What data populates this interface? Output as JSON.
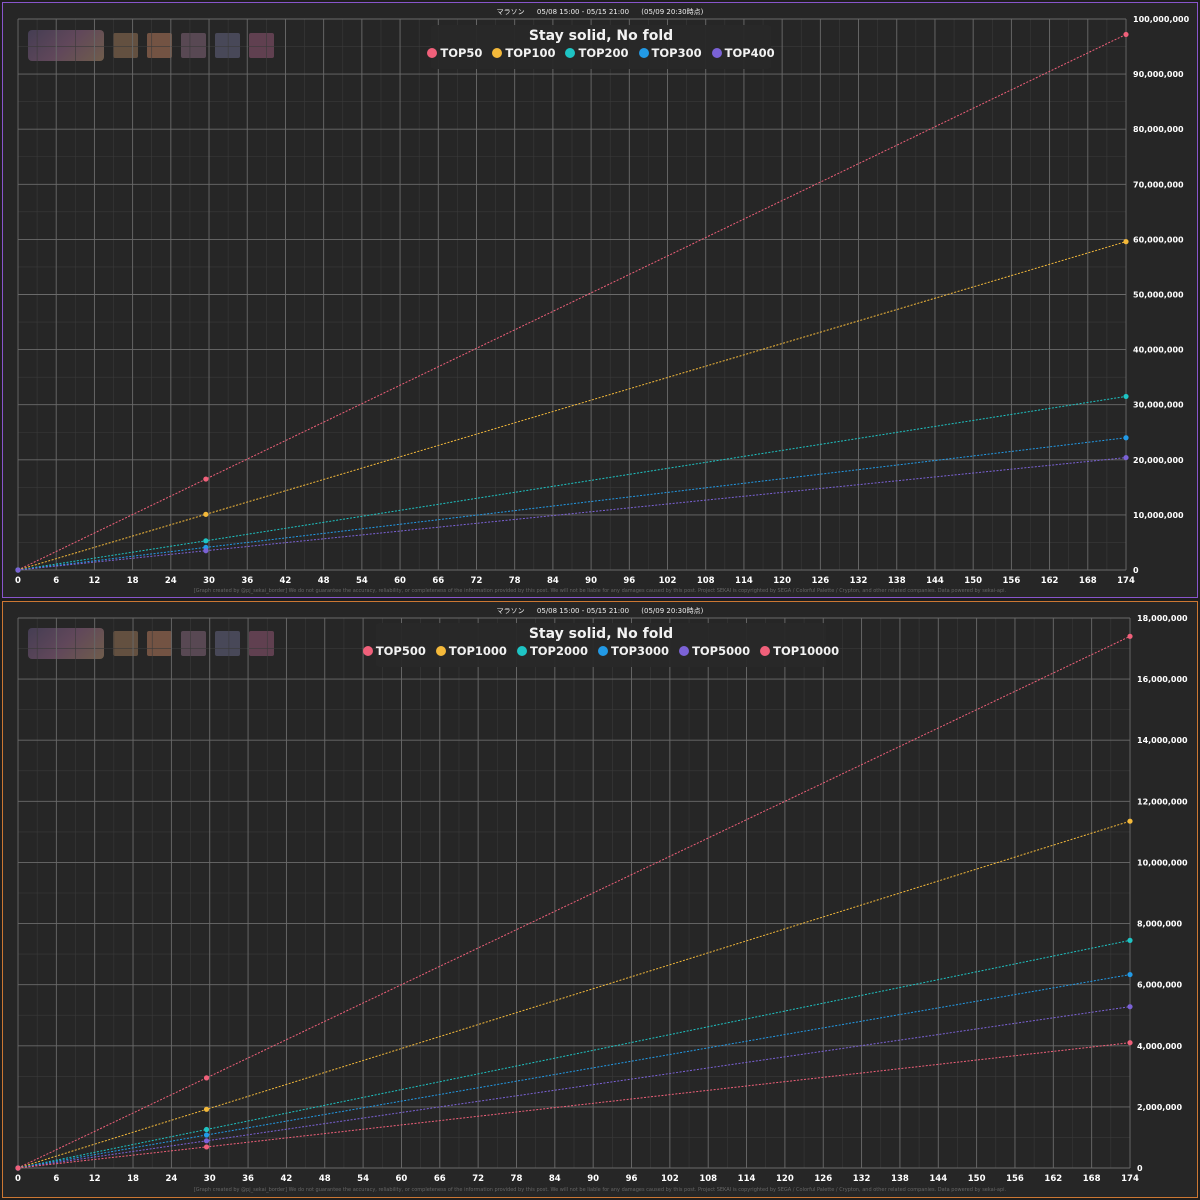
{
  "colors": {
    "red": "#f0607a",
    "yellow": "#f4b93a",
    "teal": "#1ec4c4",
    "blue": "#229ae6",
    "purple": "#7b62d6",
    "frame_top": "#8855cc",
    "frame_bottom": "#cc7733"
  },
  "header": {
    "event_type": "マラソン",
    "period": "05/08 15:00 - 05/15 21:00",
    "as_of": "(05/09 20:30時点)"
  },
  "footer_text": "[Graph created by @pj_sekai_border]  We do not guarantee the accuracy, reliability, or completeness of the information provided by this post. We will not be liable for any damages caused by this post. Project SEKAI is copyrighted by SEGA / Colorful Palette / Crypton, and other related companies. Data powered by sekai-api.",
  "thumbnails": [
    "logo-image",
    "character-1-image",
    "character-2-image",
    "character-3-image",
    "character-4-image",
    "character-5-image"
  ],
  "chart_data": [
    {
      "type": "line",
      "title": "Stay solid, No fold",
      "x_ticks": [
        0,
        6,
        12,
        18,
        24,
        30,
        36,
        42,
        48,
        54,
        60,
        66,
        72,
        78,
        84,
        90,
        96,
        102,
        108,
        114,
        120,
        126,
        132,
        138,
        144,
        150,
        156,
        162,
        168,
        174
      ],
      "xlim": [
        0,
        174
      ],
      "ylim": [
        0,
        100000000
      ],
      "y_ticks": [
        0,
        10000000,
        20000000,
        30000000,
        40000000,
        50000000,
        60000000,
        70000000,
        80000000,
        90000000,
        100000000
      ],
      "y_tick_labels": [
        "0",
        "10,000,000",
        "20,000,000",
        "30,000,000",
        "40,000,000",
        "50,000,000",
        "60,000,000",
        "70,000,000",
        "80,000,000",
        "90,000,000",
        "100,000,000"
      ],
      "grid": true,
      "legend_position": "top-center",
      "series": [
        {
          "name": "TOP50",
          "color_key": "red",
          "points": [
            [
              0,
              0
            ],
            [
              29.5,
              16500000
            ],
            [
              174,
              97200000
            ]
          ]
        },
        {
          "name": "TOP100",
          "color_key": "yellow",
          "points": [
            [
              0,
              0
            ],
            [
              29.5,
              10100000
            ],
            [
              174,
              59600000
            ]
          ]
        },
        {
          "name": "TOP200",
          "color_key": "teal",
          "points": [
            [
              0,
              0
            ],
            [
              29.5,
              5300000
            ],
            [
              174,
              31500000
            ]
          ]
        },
        {
          "name": "TOP300",
          "color_key": "blue",
          "points": [
            [
              0,
              0
            ],
            [
              29.5,
              4100000
            ],
            [
              174,
              24000000
            ]
          ]
        },
        {
          "name": "TOP400",
          "color_key": "purple",
          "points": [
            [
              0,
              0
            ],
            [
              29.5,
              3500000
            ],
            [
              174,
              20400000
            ]
          ]
        }
      ]
    },
    {
      "type": "line",
      "title": "Stay solid, No fold",
      "x_ticks": [
        0,
        6,
        12,
        18,
        24,
        30,
        36,
        42,
        48,
        54,
        60,
        66,
        72,
        78,
        84,
        90,
        96,
        102,
        108,
        114,
        120,
        126,
        132,
        138,
        144,
        150,
        156,
        162,
        168,
        174
      ],
      "xlim": [
        0,
        174
      ],
      "ylim": [
        0,
        18000000
      ],
      "y_ticks": [
        0,
        2000000,
        4000000,
        6000000,
        8000000,
        10000000,
        12000000,
        14000000,
        16000000,
        18000000
      ],
      "y_tick_labels": [
        "0",
        "2,000,000",
        "4,000,000",
        "6,000,000",
        "8,000,000",
        "10,000,000",
        "12,000,000",
        "14,000,000",
        "16,000,000",
        "18,000,000"
      ],
      "grid": true,
      "legend_position": "top-center",
      "series": [
        {
          "name": "TOP500",
          "color_key": "red",
          "points": [
            [
              0,
              0
            ],
            [
              29.5,
              2950000
            ],
            [
              174,
              17400000
            ]
          ]
        },
        {
          "name": "TOP1000",
          "color_key": "yellow",
          "points": [
            [
              0,
              0
            ],
            [
              29.5,
              1920000
            ],
            [
              174,
              11350000
            ]
          ]
        },
        {
          "name": "TOP2000",
          "color_key": "teal",
          "points": [
            [
              0,
              0
            ],
            [
              29.5,
              1260000
            ],
            [
              174,
              7450000
            ]
          ]
        },
        {
          "name": "TOP3000",
          "color_key": "blue",
          "points": [
            [
              0,
              0
            ],
            [
              29.5,
              1080000
            ],
            [
              174,
              6330000
            ]
          ]
        },
        {
          "name": "TOP5000",
          "color_key": "purple",
          "points": [
            [
              0,
              0
            ],
            [
              29.5,
              890000
            ],
            [
              174,
              5280000
            ]
          ]
        },
        {
          "name": "TOP10000",
          "color_key": "red",
          "points": [
            [
              0,
              0
            ],
            [
              29.5,
              690000
            ],
            [
              174,
              4100000
            ]
          ]
        }
      ]
    }
  ]
}
